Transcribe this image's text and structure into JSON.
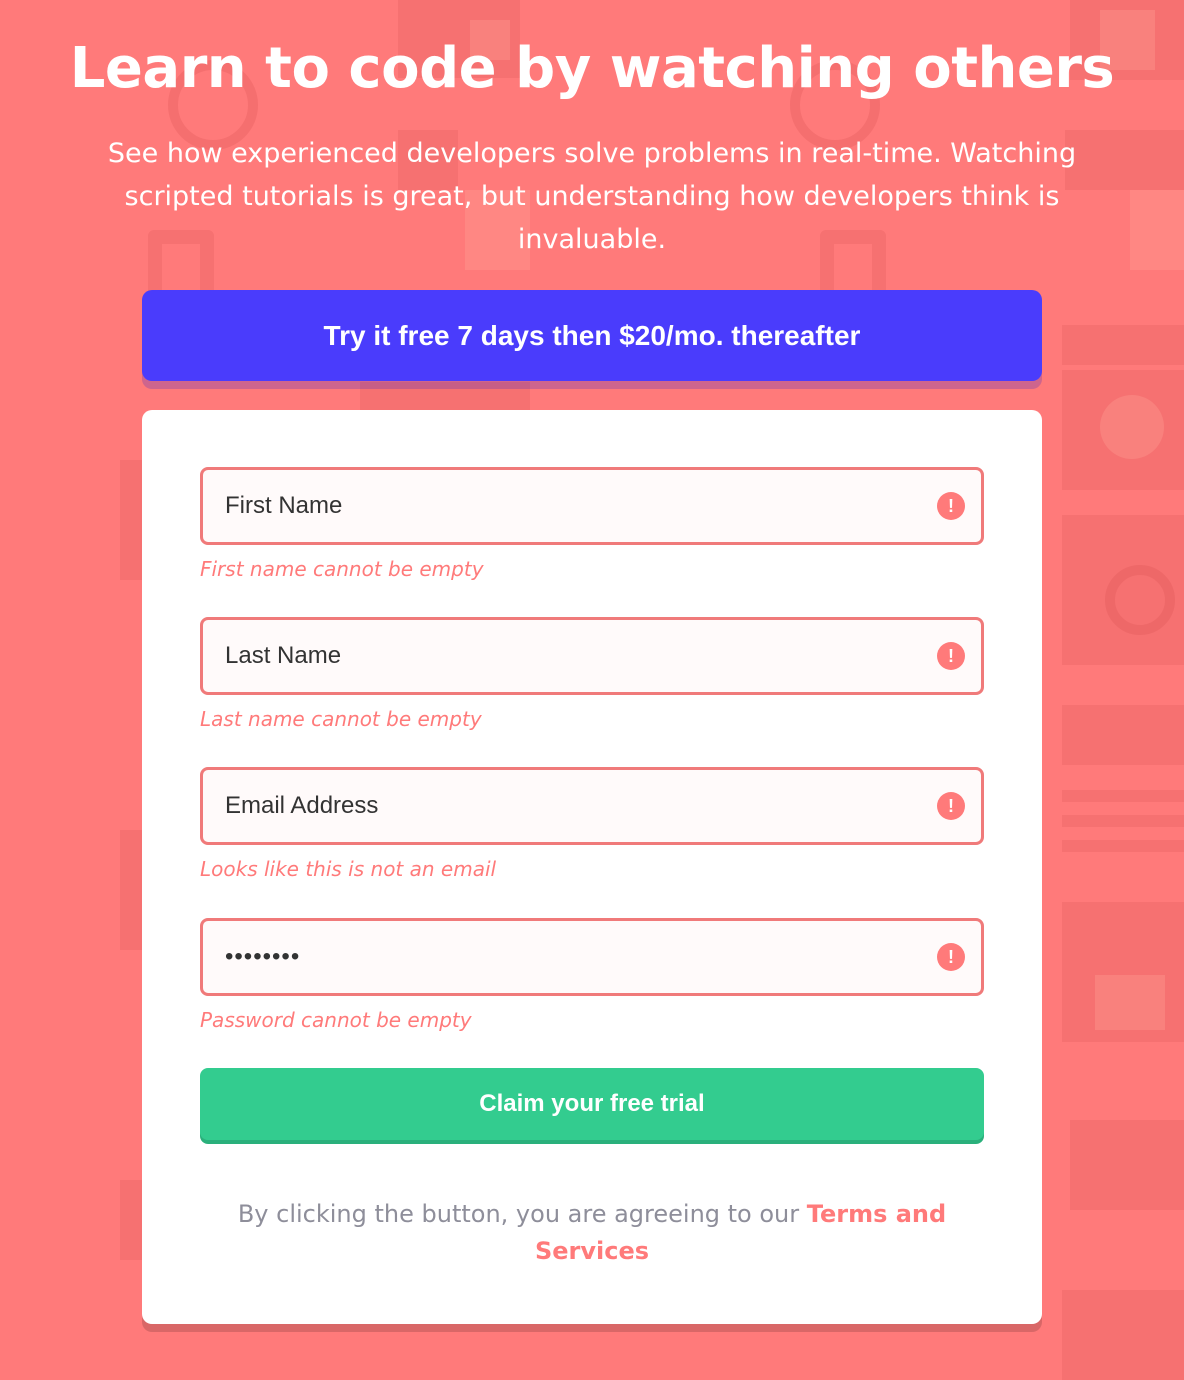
{
  "header": {
    "title": "Learn to code by watching others",
    "subtitle": "See how experienced developers solve problems in real-time. Watching scripted tutorials is great, but understanding how developers think is invaluable."
  },
  "promo": {
    "text": "Try it free 7 days then $20/mo. thereafter"
  },
  "form": {
    "fields": [
      {
        "placeholder": "First Name",
        "error": "First name cannot be empty",
        "icon": "error-icon"
      },
      {
        "placeholder": "Last Name",
        "error": "Last name cannot be empty",
        "icon": "error-icon"
      },
      {
        "placeholder": "Email Address",
        "error": "Looks like this is not an email",
        "icon": "error-icon"
      },
      {
        "placeholder": "••••••••",
        "error": "Password cannot be empty",
        "icon": "error-icon"
      }
    ],
    "error_glyph": "!",
    "submit_label": "Claim your free trial",
    "terms_prefix": "By clicking the button, you are agreeing to our ",
    "terms_link": "Terms and Services"
  },
  "colors": {
    "background": "#ff7a7a",
    "promo": "#4a3cfc",
    "submit": "#33cc8f",
    "error": "#ff7a7a",
    "muted_text": "#8e8e9a"
  }
}
